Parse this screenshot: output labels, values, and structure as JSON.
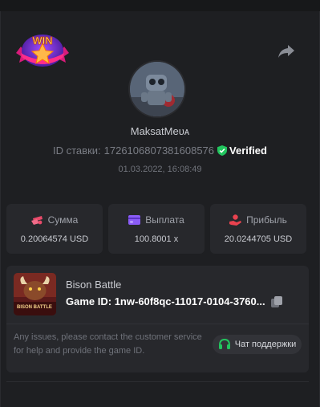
{
  "badge": {
    "text": "WIN"
  },
  "icons": {
    "share": "share-arrow-icon",
    "verified": "shield-check-icon",
    "copy": "copy-icon",
    "support": "headset-icon"
  },
  "player": {
    "username": "MaksatMeᴜᴀ",
    "bet_id_label": "ID ставки:",
    "bet_id": "1726106807381608576",
    "verified_label": "Verified",
    "datetime": "01.03.2022, 16:08:49"
  },
  "stats": [
    {
      "icon": "coins-icon",
      "label": "Сумма",
      "value": "0.20064574 USD",
      "color": "#e94a6a"
    },
    {
      "icon": "wallet-icon",
      "label": "Выплата",
      "value": "100.8001 x",
      "color": "#8a5cf6"
    },
    {
      "icon": "profit-hand-icon",
      "label": "Прибыль",
      "value": "20.0244705 USD",
      "color": "#e9424f"
    }
  ],
  "game": {
    "thumb_text": "BISON BATTLE",
    "title": "Bison Battle",
    "id_label": "Game ID:",
    "id_value": "1nw-60f8qc-11017-0104-3760...",
    "issues_text": "Any issues, please contact the customer service for help and provide the game ID.",
    "support_label": "Чат поддержки"
  },
  "colors": {
    "accent_green": "#22c55e",
    "panel": "#1e1f22",
    "card": "#27282c"
  }
}
